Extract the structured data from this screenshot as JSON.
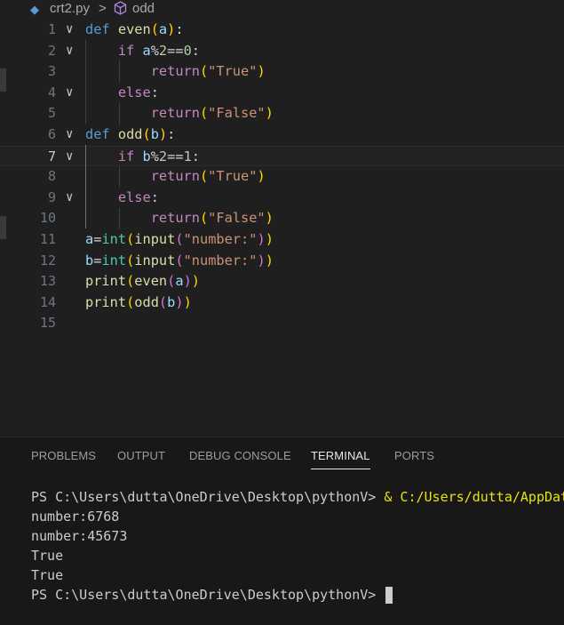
{
  "breadcrumb": {
    "file": "crt2.py",
    "separator": ">",
    "symbol": "odd"
  },
  "editor": {
    "lines": [
      {
        "n": "1",
        "fold": "∨",
        "current": false,
        "tokens": [
          [
            "k",
            "def"
          ],
          [
            "o",
            " "
          ],
          [
            "f",
            "even"
          ],
          [
            "b1",
            "("
          ],
          [
            "v",
            "a"
          ],
          [
            "b1",
            ")"
          ],
          [
            "o",
            ":"
          ]
        ]
      },
      {
        "n": "2",
        "fold": "∨",
        "current": false,
        "tokens": [
          [
            "o",
            "    "
          ],
          [
            "c",
            "if"
          ],
          [
            "o",
            " "
          ],
          [
            "v",
            "a"
          ],
          [
            "o",
            "%"
          ],
          [
            "n",
            "2"
          ],
          [
            "o",
            "=="
          ],
          [
            "n",
            "0"
          ],
          [
            "o",
            ":"
          ]
        ]
      },
      {
        "n": "3",
        "fold": "",
        "current": false,
        "tokens": [
          [
            "o",
            "        "
          ],
          [
            "c",
            "return"
          ],
          [
            "b1",
            "("
          ],
          [
            "s",
            "\"True\""
          ],
          [
            "b1",
            ")"
          ]
        ]
      },
      {
        "n": "4",
        "fold": "∨",
        "current": false,
        "tokens": [
          [
            "o",
            "    "
          ],
          [
            "c",
            "else"
          ],
          [
            "o",
            ":"
          ]
        ]
      },
      {
        "n": "5",
        "fold": "",
        "current": false,
        "tokens": [
          [
            "o",
            "        "
          ],
          [
            "c",
            "return"
          ],
          [
            "b1",
            "("
          ],
          [
            "s",
            "\"False\""
          ],
          [
            "b1",
            ")"
          ]
        ]
      },
      {
        "n": "6",
        "fold": "∨",
        "current": false,
        "tokens": [
          [
            "k",
            "def"
          ],
          [
            "o",
            " "
          ],
          [
            "f",
            "odd"
          ],
          [
            "b1",
            "("
          ],
          [
            "v",
            "b"
          ],
          [
            "b1",
            ")"
          ],
          [
            "o",
            ":"
          ]
        ]
      },
      {
        "n": "7",
        "fold": "∨",
        "current": true,
        "tokens": [
          [
            "o",
            "    "
          ],
          [
            "c",
            "if"
          ],
          [
            "o",
            " "
          ],
          [
            "v",
            "b"
          ],
          [
            "o",
            "%"
          ],
          [
            "n",
            "2"
          ],
          [
            "o",
            "=="
          ],
          [
            "n",
            "1"
          ],
          [
            "o",
            ":"
          ]
        ]
      },
      {
        "n": "8",
        "fold": "",
        "current": false,
        "tokens": [
          [
            "o",
            "        "
          ],
          [
            "c",
            "return"
          ],
          [
            "b1",
            "("
          ],
          [
            "s",
            "\"True\""
          ],
          [
            "b1",
            ")"
          ]
        ]
      },
      {
        "n": "9",
        "fold": "∨",
        "current": false,
        "tokens": [
          [
            "o",
            "    "
          ],
          [
            "c",
            "else"
          ],
          [
            "o",
            ":"
          ]
        ]
      },
      {
        "n": "10",
        "fold": "",
        "current": false,
        "tokens": [
          [
            "o",
            "        "
          ],
          [
            "c",
            "return"
          ],
          [
            "b1",
            "("
          ],
          [
            "s",
            "\"False\""
          ],
          [
            "b1",
            ")"
          ]
        ]
      },
      {
        "n": "11",
        "fold": "",
        "current": false,
        "tokens": [
          [
            "v",
            "a"
          ],
          [
            "o",
            "="
          ],
          [
            "t",
            "int"
          ],
          [
            "b1",
            "("
          ],
          [
            "f",
            "input"
          ],
          [
            "b2",
            "("
          ],
          [
            "s",
            "\"number:\""
          ],
          [
            "b2",
            ")"
          ],
          [
            "b1",
            ")"
          ]
        ]
      },
      {
        "n": "12",
        "fold": "",
        "current": false,
        "tokens": [
          [
            "v",
            "b"
          ],
          [
            "o",
            "="
          ],
          [
            "t",
            "int"
          ],
          [
            "b1",
            "("
          ],
          [
            "f",
            "input"
          ],
          [
            "b2",
            "("
          ],
          [
            "s",
            "\"number:\""
          ],
          [
            "b2",
            ")"
          ],
          [
            "b1",
            ")"
          ]
        ]
      },
      {
        "n": "13",
        "fold": "",
        "current": false,
        "tokens": [
          [
            "f",
            "print"
          ],
          [
            "b1",
            "("
          ],
          [
            "f",
            "even"
          ],
          [
            "b2",
            "("
          ],
          [
            "v",
            "a"
          ],
          [
            "b2",
            ")"
          ],
          [
            "b1",
            ")"
          ]
        ]
      },
      {
        "n": "14",
        "fold": "",
        "current": false,
        "tokens": [
          [
            "f",
            "print"
          ],
          [
            "b1",
            "("
          ],
          [
            "f",
            "odd"
          ],
          [
            "b2",
            "("
          ],
          [
            "v",
            "b"
          ],
          [
            "b2",
            ")"
          ],
          [
            "b1",
            ")"
          ]
        ]
      },
      {
        "n": "15",
        "fold": "",
        "current": false,
        "tokens": []
      }
    ]
  },
  "panel": {
    "tabs": [
      {
        "label": "PROBLEMS",
        "active": false
      },
      {
        "label": "OUTPUT",
        "active": false
      },
      {
        "label": "DEBUG CONSOLE",
        "active": false
      },
      {
        "label": "TERMINAL",
        "active": true
      },
      {
        "label": "PORTS",
        "active": false
      }
    ],
    "terminal": {
      "prompt1": "PS C:\\Users\\dutta\\OneDrive\\Desktop\\pythonV> ",
      "command1": "& C:/Users/dutta/AppData",
      "out1": "number:6768",
      "out2": "number:45673",
      "out3": "True",
      "out4": "True",
      "prompt2": "PS C:\\Users\\dutta\\OneDrive\\Desktop\\pythonV> "
    }
  },
  "colors": {
    "editor_bg": "#1f1f1f",
    "panel_bg": "#181818",
    "keyword": "#569cd6",
    "control": "#c586c0",
    "function": "#dcdcaa",
    "string": "#ce9178",
    "number": "#b5cea8",
    "type": "#4ec9b0"
  }
}
